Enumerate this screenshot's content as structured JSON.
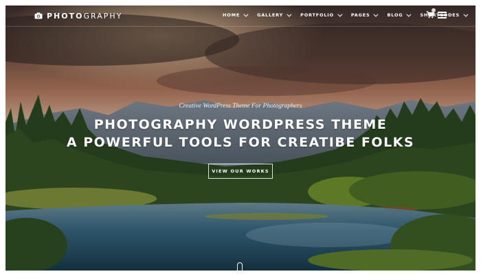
{
  "logo": {
    "text_bold": "PHOTO",
    "text_light": "GRAPHY",
    "icon": "camera-icon"
  },
  "nav": {
    "items": [
      {
        "label": "HOME"
      },
      {
        "label": "GALLERY"
      },
      {
        "label": "PORTFOLIO"
      },
      {
        "label": "PAGES"
      },
      {
        "label": "BLOG"
      },
      {
        "label": "SHORTCODES"
      }
    ],
    "cart_icon": "cart-icon",
    "menu_icon": "hamburger-menu-icon"
  },
  "hero": {
    "tagline": "Creative WordPress Theme For Photographers",
    "heading_line1": "PHOTOGRAPHY WORDPRESS THEME",
    "heading_line2": "A POWERFUL TOOLS FOR CREATIBE FOLKS",
    "cta_label": "VIEW OUR WORKS",
    "scroll_icon": "mouse-scroll-icon"
  },
  "colors": {
    "accent_text": "#ffffff",
    "sky": "#b07a5a",
    "water": "#2f5f72",
    "forest": "#2d4a22"
  }
}
